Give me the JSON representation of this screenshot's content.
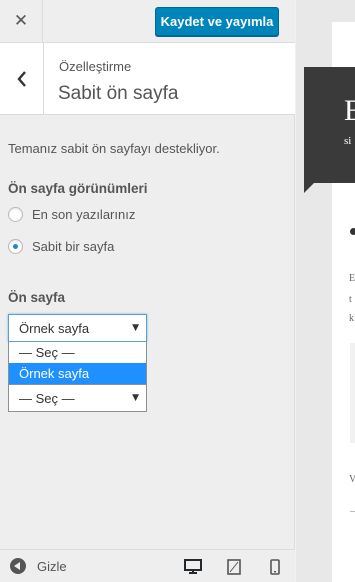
{
  "topbar": {
    "close_symbol": "✕",
    "publish_label": "Kaydet ve yayımla"
  },
  "section": {
    "breadcrumb": "Özelleştirme",
    "title": "Sabit ön sayfa"
  },
  "description": "Temanız sabit ön sayfayı destekliyor.",
  "front_display": {
    "label": "Ön sayfa görünümleri",
    "options": [
      {
        "label": "En son yazılarınız",
        "checked": false
      },
      {
        "label": "Sabit bir sayfa",
        "checked": true
      }
    ]
  },
  "front_page": {
    "label": "Ön sayfa",
    "selected": "Örnek sayfa",
    "dropdown_options": [
      "— Seç —",
      "Örnek sayfa"
    ],
    "highlighted_index": 1
  },
  "posts_page": {
    "selected": "— Seç —"
  },
  "footer": {
    "collapse_label": "Gizle"
  },
  "preview": {
    "big_letter": "E",
    "small_text": "si",
    "line1": "E",
    "line2": "t",
    "line3": "k",
    "line4": "V"
  },
  "colors": {
    "accent": "#0085ba",
    "highlight": "#1e90ff",
    "sidebar_bg": "#eeeeee"
  },
  "icons": [
    "close-icon",
    "back-chevron-icon",
    "collapse-icon",
    "desktop-icon",
    "tablet-icon",
    "mobile-icon"
  ]
}
